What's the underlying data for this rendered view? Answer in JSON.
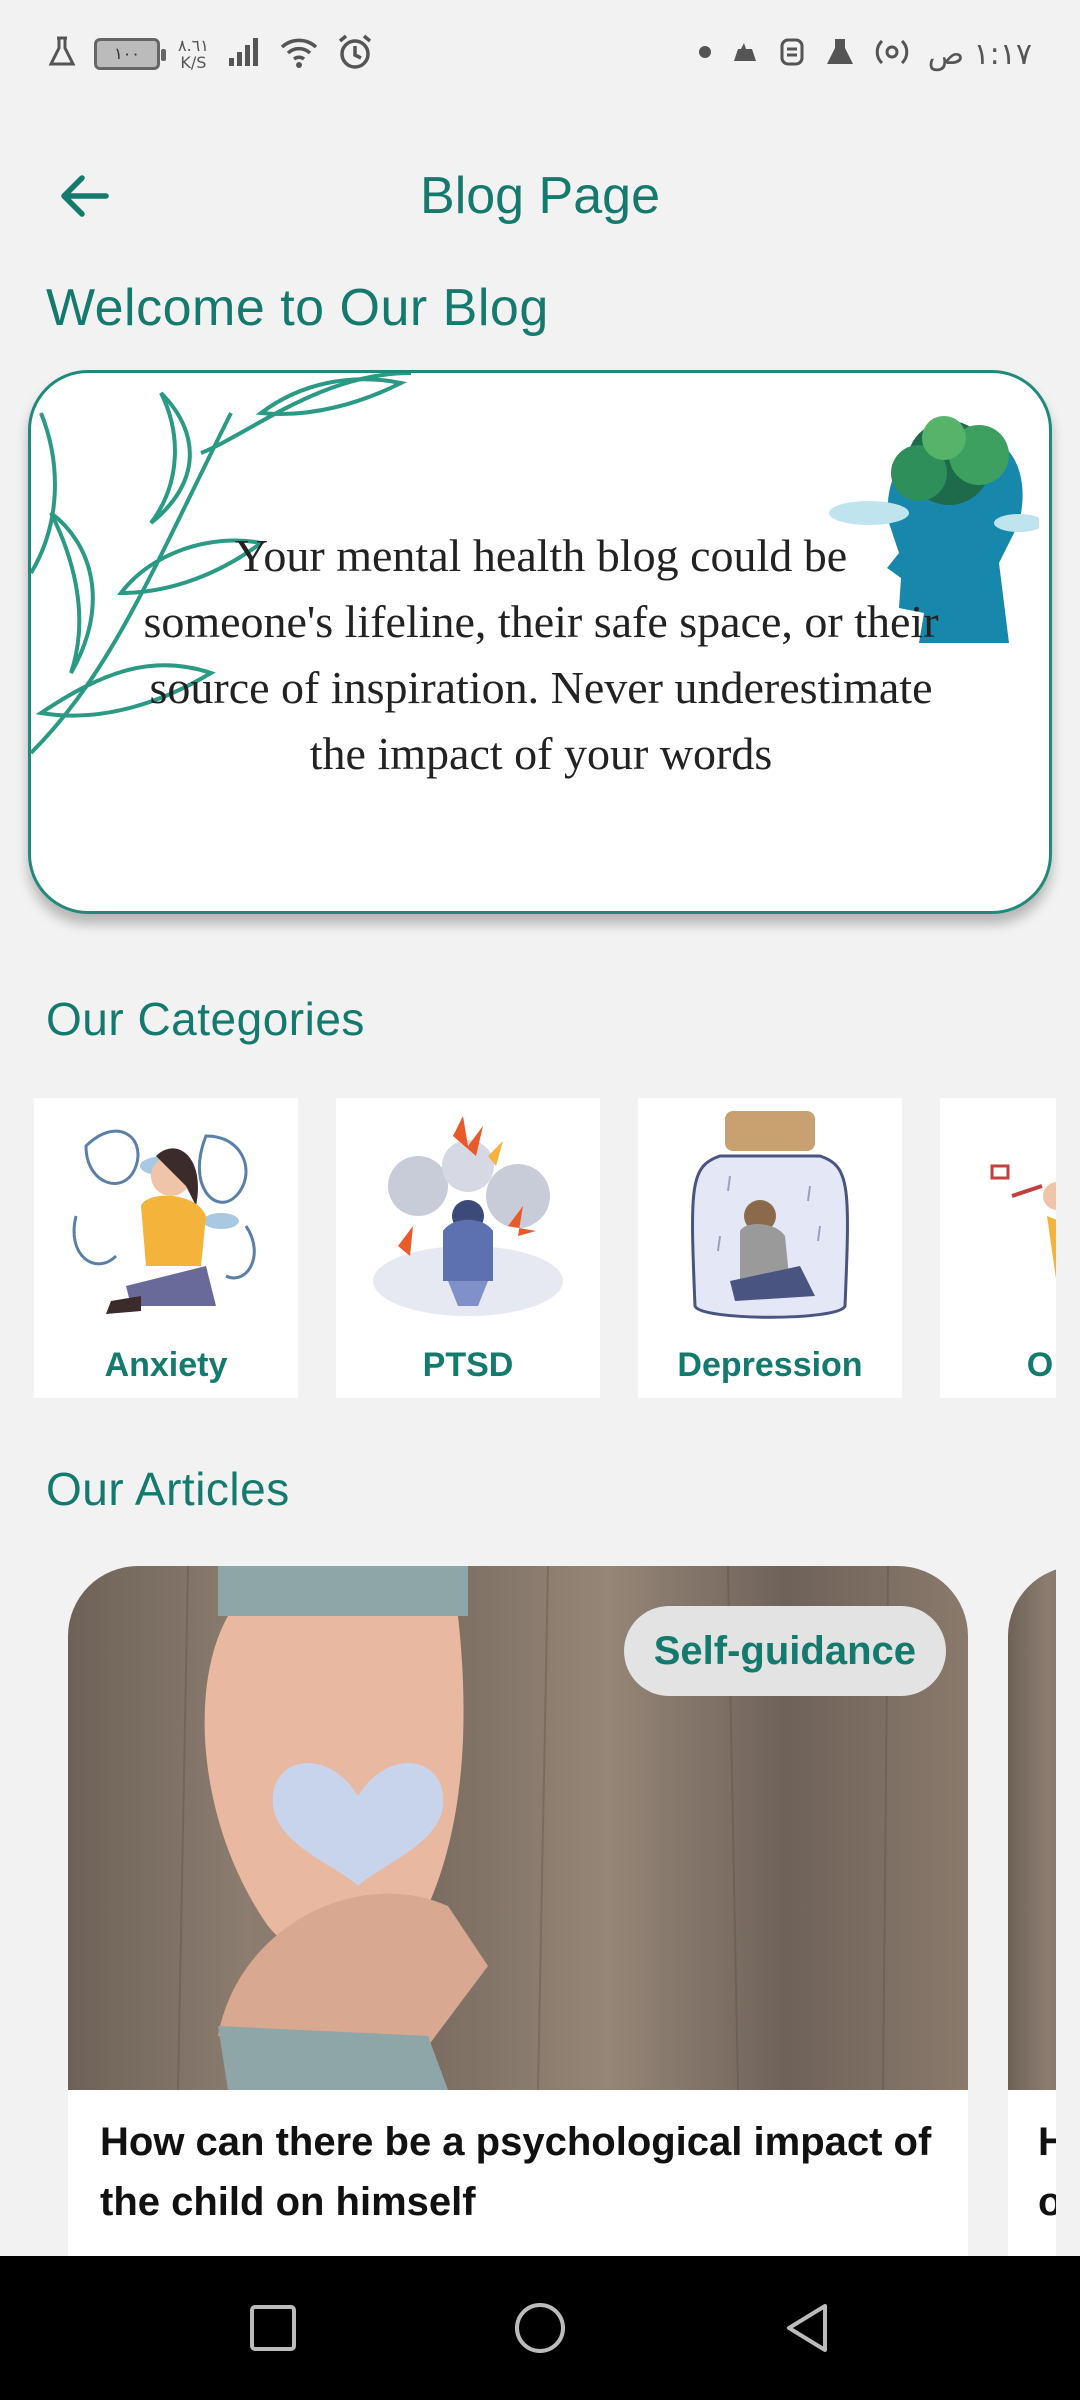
{
  "status_bar": {
    "time": "١:١٧ ص",
    "net_speed": "٨.٦١",
    "net_unit": "K/S",
    "battery": "١٠٠"
  },
  "header": {
    "title": "Blog Page"
  },
  "welcome": {
    "title": "Welcome to Our Blog",
    "quote": "Your mental health blog could be someone's lifeline, their safe space, or their source of inspiration. Never underestimate the impact of your words"
  },
  "categories": {
    "title": "Our Categories",
    "items": [
      {
        "label": "Anxiety"
      },
      {
        "label": "PTSD"
      },
      {
        "label": "Depression"
      },
      {
        "label": "O"
      }
    ]
  },
  "articles": {
    "title": "Our Articles",
    "items": [
      {
        "badge": "Self-guidance",
        "title": "How can there be a psychological impact of the child on himself"
      },
      {
        "title": "H o"
      }
    ]
  },
  "colors": {
    "accent": "#157a6e",
    "background": "#f2f2f2"
  }
}
